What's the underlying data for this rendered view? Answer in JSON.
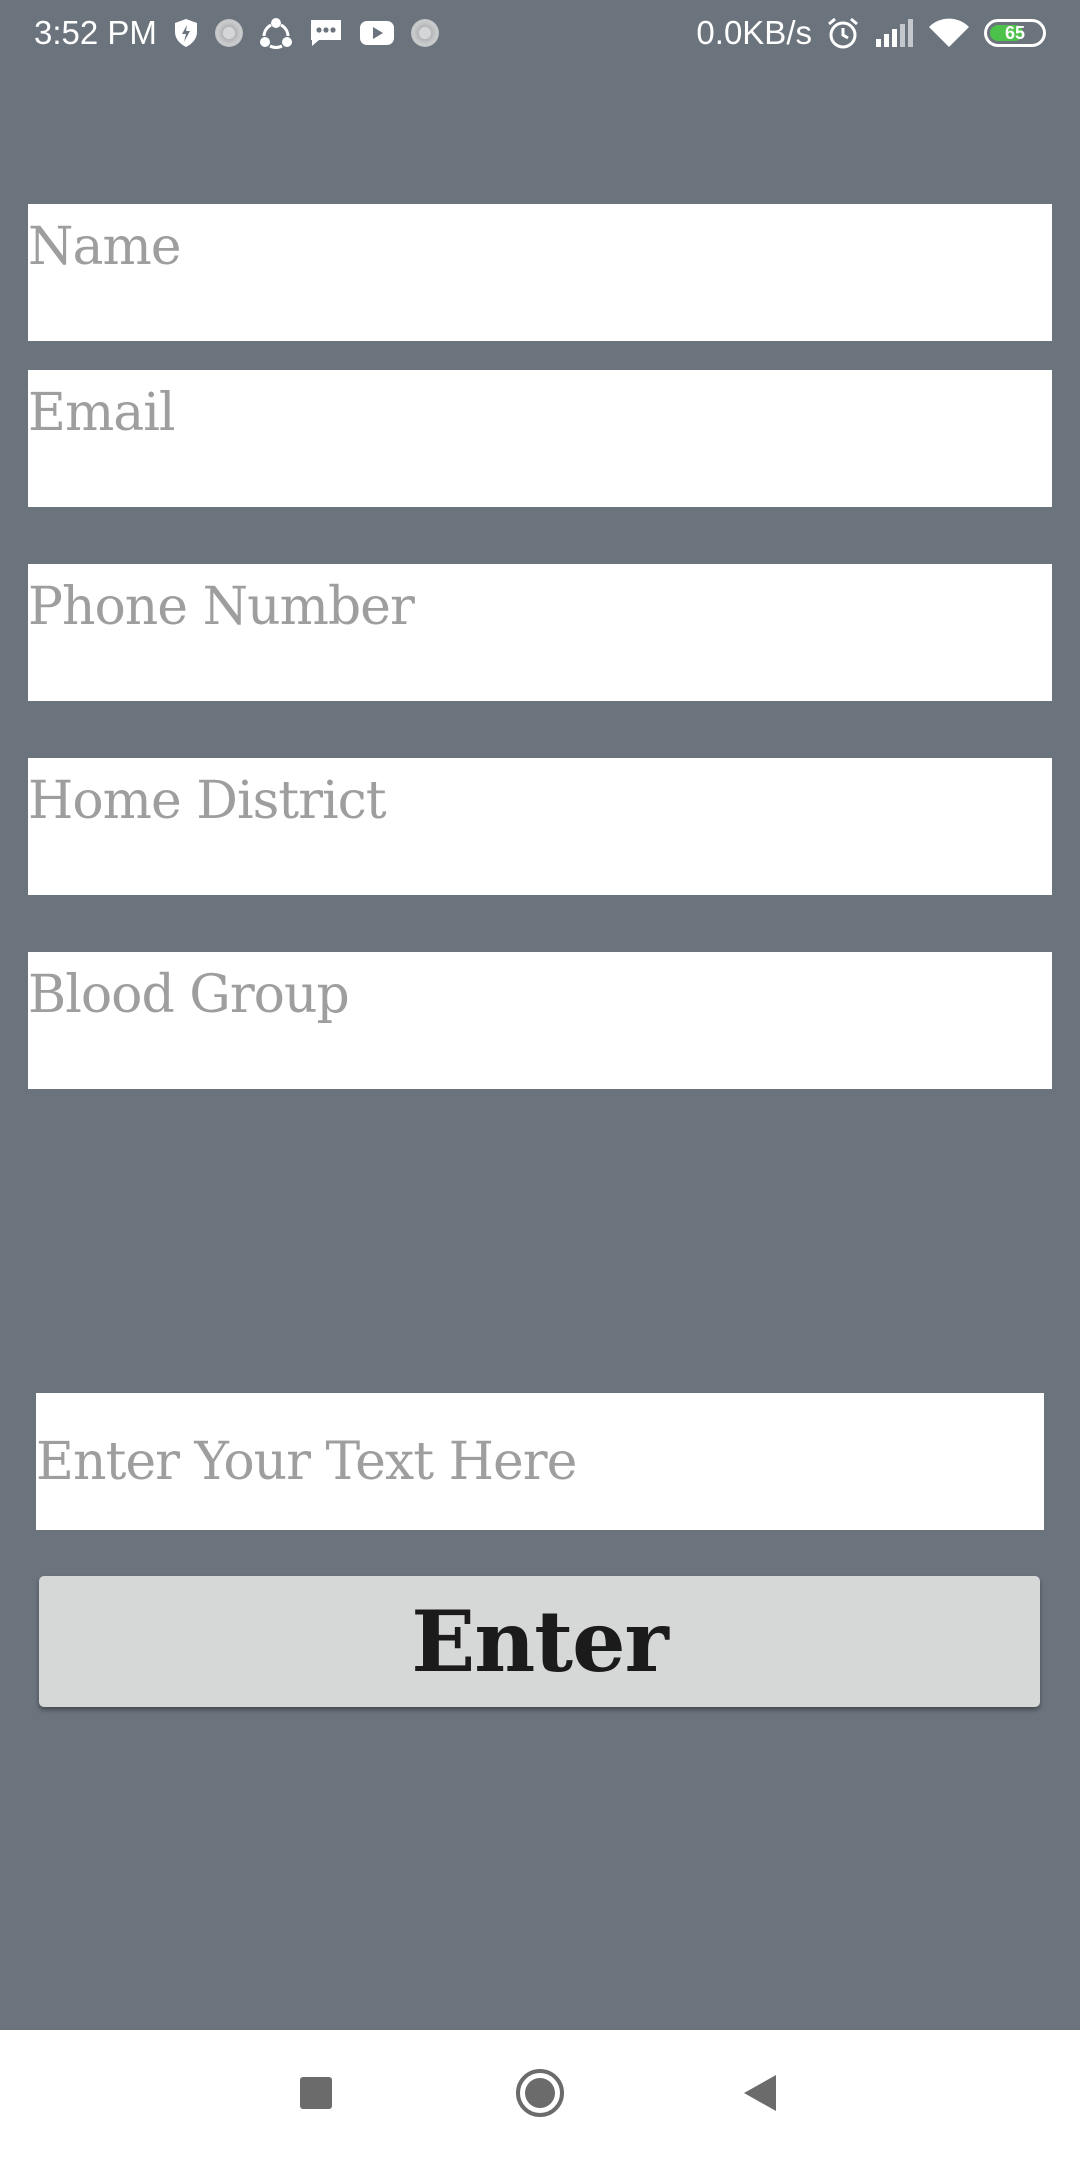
{
  "status_bar": {
    "time": "3:52 PM",
    "net_speed": "0.0KB/s",
    "battery_level": "65",
    "battery_color": "#4cc24a",
    "left_icons": [
      "shield-bolt-icon",
      "dotted-circle-icon",
      "share-nodes-icon",
      "message-icon",
      "youtube-icon",
      "dotted-circle-icon"
    ],
    "right_icons": [
      "alarm-icon",
      "signal-icon",
      "wifi-icon",
      "battery-icon"
    ]
  },
  "form": {
    "name_placeholder": "Name",
    "email_placeholder": "Email",
    "phone_placeholder": "Phone Number",
    "district_placeholder": "Home District",
    "blood_placeholder": "Blood Group"
  },
  "search": {
    "placeholder": "Enter Your Text Here",
    "button_label": "Enter"
  },
  "nav_bar": {
    "buttons": [
      "recents-icon",
      "home-icon",
      "back-icon"
    ]
  },
  "colors": {
    "background": "#6b737d",
    "field_background": "#ffffff",
    "placeholder_text": "#9e9e9e",
    "button_background": "#d6d7d7"
  }
}
